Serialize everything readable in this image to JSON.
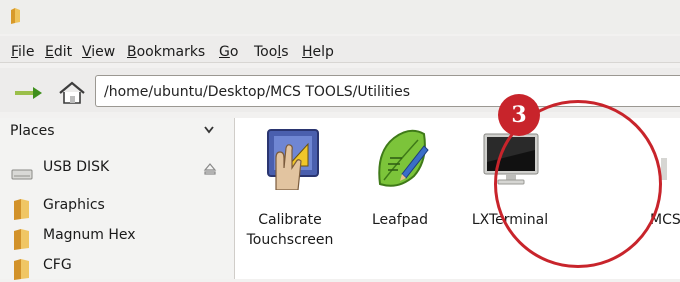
{
  "menubar": {
    "items": [
      {
        "pre": "",
        "mn": "F",
        "post": "ile"
      },
      {
        "pre": "",
        "mn": "E",
        "post": "dit"
      },
      {
        "pre": "",
        "mn": "V",
        "post": "iew"
      },
      {
        "pre": "",
        "mn": "B",
        "post": "ookmarks"
      },
      {
        "pre": "",
        "mn": "G",
        "post": "o"
      },
      {
        "pre": "Too",
        "mn": "l",
        "post": "s"
      },
      {
        "pre": "",
        "mn": "H",
        "post": "elp"
      }
    ]
  },
  "pathbar": {
    "path": "/home/ubuntu/Desktop/MCS TOOLS/Utilities"
  },
  "sidebar": {
    "header": "Places",
    "items": [
      {
        "label": "USB DISK",
        "icon": "usb-drive-icon"
      },
      {
        "label": "Graphics",
        "icon": "folder-icon"
      },
      {
        "label": "Magnum Hex",
        "icon": "folder-icon"
      },
      {
        "label": "CFG",
        "icon": "folder-icon"
      }
    ]
  },
  "files": [
    {
      "line1": "Calibrate",
      "line2": "Touchscreen",
      "icon": "calibrate-touchscreen-icon"
    },
    {
      "line1": "Leafpad",
      "line2": "",
      "icon": "leafpad-icon"
    },
    {
      "line1": "LXTerminal",
      "line2": "",
      "icon": "terminal-icon"
    },
    {
      "line1": "MCS",
      "line2": "",
      "icon": "app-icon"
    }
  ],
  "annotation": {
    "step_number": "3",
    "color": "#c8242b"
  }
}
